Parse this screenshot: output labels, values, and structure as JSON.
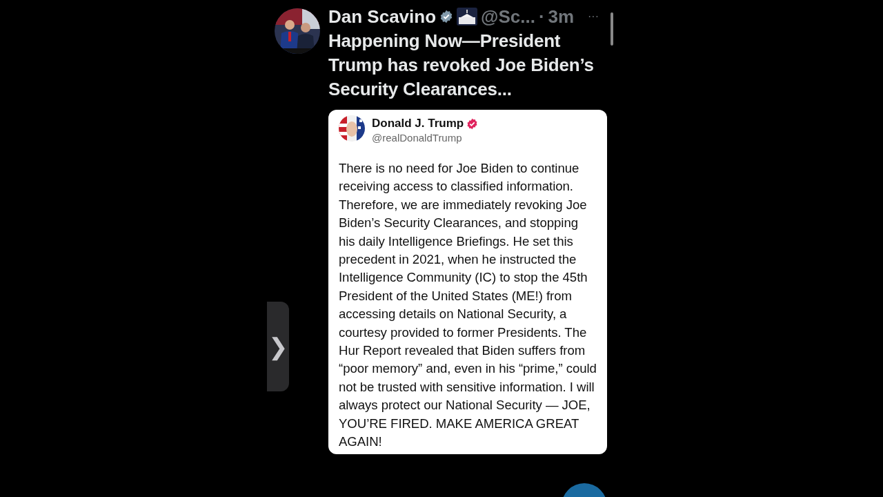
{
  "post": {
    "author": "Dan Scavino",
    "verified": true,
    "handle": "@Sc...",
    "separator": "·",
    "time": "3m",
    "more": "···",
    "text": "Happening Now—President Trump has revoked Joe Biden’s Security Clearances...",
    "quote": {
      "author": "Donald J. Trump",
      "verified": true,
      "handle": "@realDonaldTrump",
      "text": "There is no need for Joe Biden to continue receiving access to classified information. Therefore, we are immediately revoking Joe Biden’s Security Clearances, and stopping his daily Intelligence Briefings. He set this precedent in 2021, when he instructed the Intelligence Community (IC) to stop the 45th President of the United States (ME!) from accessing details on National Security, a courtesy provided to former Presidents. The Hur Report revealed that Biden suffers from “poor memory” and, even in his “prime,” could not be trusted with sensitive information. I will always protect our National Security — JOE, YOU’RE FIRED. MAKE AMERICA GREAT AGAIN!"
    }
  },
  "side_handle": {
    "glyph": "❯"
  }
}
